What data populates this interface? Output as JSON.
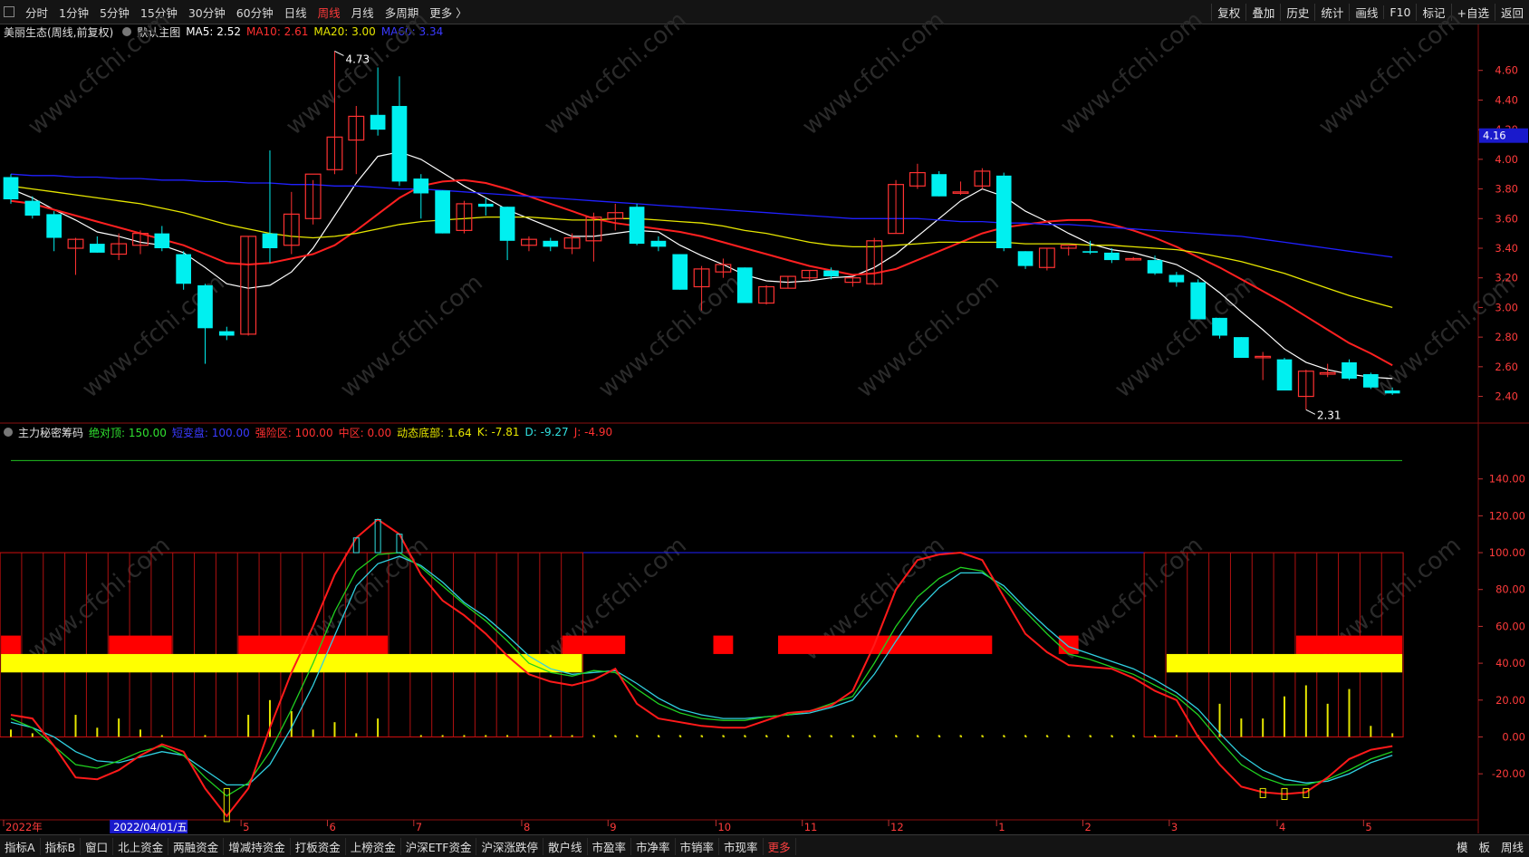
{
  "toolbar": {
    "periods": [
      "分时",
      "1分钟",
      "5分钟",
      "15分钟",
      "30分钟",
      "60分钟",
      "日线",
      "周线",
      "月线",
      "多周期",
      "更多 〉"
    ],
    "active_period": "周线",
    "right_buttons": [
      "复权",
      "叠加",
      "历史",
      "统计",
      "画线",
      "F10",
      "标记",
      "+自选",
      "返回"
    ]
  },
  "main_info": {
    "stock": "美丽生态(周线,前复权)",
    "template": "默认主图",
    "ma5": "MA5: 2.52",
    "ma10": "MA10: 2.61",
    "ma20": "MA20: 3.00",
    "ma60": "MA60: 3.34"
  },
  "indicator_info": {
    "name": "主力秘密筹码",
    "v1": "绝对顶: 150.00",
    "v2": "短变盘: 100.00",
    "v3": "强险区: 100.00",
    "v4": "中区: 0.00",
    "v5": "动态底部: 1.64",
    "k": "K: -7.81",
    "d": "D: -9.27",
    "j": "J: -4.90"
  },
  "price_axis": [
    "4.60",
    "4.40",
    "4.20",
    "4.00",
    "3.80",
    "3.60",
    "3.40",
    "3.20",
    "3.00",
    "2.80",
    "2.60",
    "2.40"
  ],
  "price_current": "4.16",
  "ind_axis": [
    "140.00",
    "120.00",
    "100.00",
    "80.00",
    "60.00",
    "40.00",
    "20.00",
    "0.00",
    "-20.00"
  ],
  "annotations": {
    "high": "4.73",
    "low": "2.31"
  },
  "x_labels": [
    "2022年",
    "2022/04/01/五",
    "5",
    "6",
    "7",
    "8",
    "9",
    "10",
    "11",
    "12",
    "1",
    "2",
    "3",
    "4",
    "5"
  ],
  "bottom_tabs": [
    "指标A",
    "指标B",
    "窗口",
    "北上资金",
    "两融资金",
    "增减持资金",
    "打板资金",
    "上榜资金",
    "沪深ETF资金",
    "沪深涨跌停",
    "散户线",
    "市盈率",
    "市净率",
    "市销率",
    "市现率",
    "更多"
  ],
  "bottom_right": [
    "模",
    "板",
    "周线"
  ],
  "watermark": "www.cfchi.com",
  "colors": {
    "up": "#ff3232",
    "down": "#00f0f0",
    "ma5": "#ffffff",
    "ma10": "#ff2020",
    "ma20": "#e6e600",
    "ma60": "#2020ff",
    "accent": "#ff3b3b"
  },
  "chart_data": {
    "type": "candlestick",
    "candles": [
      {
        "o": 3.88,
        "h": 3.9,
        "l": 3.7,
        "c": 3.73
      },
      {
        "o": 3.72,
        "h": 3.75,
        "l": 3.6,
        "c": 3.62
      },
      {
        "o": 3.63,
        "h": 3.65,
        "l": 3.38,
        "c": 3.47
      },
      {
        "o": 3.4,
        "h": 3.47,
        "l": 3.22,
        "c": 3.46
      },
      {
        "o": 3.43,
        "h": 3.48,
        "l": 3.37,
        "c": 3.37
      },
      {
        "o": 3.36,
        "h": 3.5,
        "l": 3.32,
        "c": 3.43
      },
      {
        "o": 3.42,
        "h": 3.52,
        "l": 3.36,
        "c": 3.5
      },
      {
        "o": 3.5,
        "h": 3.55,
        "l": 3.38,
        "c": 3.4
      },
      {
        "o": 3.36,
        "h": 3.38,
        "l": 3.12,
        "c": 3.16
      },
      {
        "o": 3.15,
        "h": 3.16,
        "l": 2.62,
        "c": 2.86
      },
      {
        "o": 2.84,
        "h": 2.87,
        "l": 2.78,
        "c": 2.81
      },
      {
        "o": 2.82,
        "h": 3.48,
        "l": 2.81,
        "c": 3.48
      },
      {
        "o": 3.5,
        "h": 4.06,
        "l": 3.3,
        "c": 3.4
      },
      {
        "o": 3.42,
        "h": 3.78,
        "l": 3.36,
        "c": 3.63
      },
      {
        "o": 3.6,
        "h": 3.86,
        "l": 3.56,
        "c": 3.9
      },
      {
        "o": 3.93,
        "h": 4.73,
        "l": 3.9,
        "c": 4.15
      },
      {
        "o": 4.13,
        "h": 4.36,
        "l": 3.9,
        "c": 4.29
      },
      {
        "o": 4.3,
        "h": 4.62,
        "l": 4.16,
        "c": 4.2
      },
      {
        "o": 4.36,
        "h": 4.56,
        "l": 3.82,
        "c": 3.85
      },
      {
        "o": 3.87,
        "h": 3.9,
        "l": 3.6,
        "c": 3.77
      },
      {
        "o": 3.79,
        "h": 3.79,
        "l": 3.5,
        "c": 3.5
      },
      {
        "o": 3.52,
        "h": 3.72,
        "l": 3.5,
        "c": 3.7
      },
      {
        "o": 3.7,
        "h": 3.74,
        "l": 3.62,
        "c": 3.68
      },
      {
        "o": 3.68,
        "h": 3.68,
        "l": 3.32,
        "c": 3.45
      },
      {
        "o": 3.42,
        "h": 3.48,
        "l": 3.38,
        "c": 3.46
      },
      {
        "o": 3.45,
        "h": 3.47,
        "l": 3.38,
        "c": 3.41
      },
      {
        "o": 3.4,
        "h": 3.5,
        "l": 3.36,
        "c": 3.47
      },
      {
        "o": 3.45,
        "h": 3.64,
        "l": 3.31,
        "c": 3.61
      },
      {
        "o": 3.6,
        "h": 3.7,
        "l": 3.52,
        "c": 3.64
      },
      {
        "o": 3.68,
        "h": 3.7,
        "l": 3.42,
        "c": 3.43
      },
      {
        "o": 3.45,
        "h": 3.48,
        "l": 3.38,
        "c": 3.41
      },
      {
        "o": 3.36,
        "h": 3.36,
        "l": 3.12,
        "c": 3.12
      },
      {
        "o": 3.14,
        "h": 3.28,
        "l": 2.98,
        "c": 3.26
      },
      {
        "o": 3.24,
        "h": 3.33,
        "l": 3.2,
        "c": 3.29
      },
      {
        "o": 3.27,
        "h": 3.27,
        "l": 3.03,
        "c": 3.03
      },
      {
        "o": 3.03,
        "h": 3.15,
        "l": 3.02,
        "c": 3.14
      },
      {
        "o": 3.13,
        "h": 3.21,
        "l": 3.13,
        "c": 3.21
      },
      {
        "o": 3.2,
        "h": 3.25,
        "l": 3.18,
        "c": 3.25
      },
      {
        "o": 3.25,
        "h": 3.27,
        "l": 3.19,
        "c": 3.21
      },
      {
        "o": 3.17,
        "h": 3.2,
        "l": 3.14,
        "c": 3.2
      },
      {
        "o": 3.16,
        "h": 3.47,
        "l": 3.15,
        "c": 3.45
      },
      {
        "o": 3.5,
        "h": 3.86,
        "l": 3.5,
        "c": 3.83
      },
      {
        "o": 3.82,
        "h": 3.97,
        "l": 3.8,
        "c": 3.91
      },
      {
        "o": 3.9,
        "h": 3.92,
        "l": 3.75,
        "c": 3.75
      },
      {
        "o": 3.78,
        "h": 3.85,
        "l": 3.76,
        "c": 3.78
      },
      {
        "o": 3.82,
        "h": 3.94,
        "l": 3.8,
        "c": 3.92
      },
      {
        "o": 3.89,
        "h": 3.91,
        "l": 3.38,
        "c": 3.4
      },
      {
        "o": 3.38,
        "h": 3.38,
        "l": 3.26,
        "c": 3.28
      },
      {
        "o": 3.27,
        "h": 3.4,
        "l": 3.25,
        "c": 3.4
      },
      {
        "o": 3.4,
        "h": 3.41,
        "l": 3.35,
        "c": 3.42
      },
      {
        "o": 3.38,
        "h": 3.45,
        "l": 3.36,
        "c": 3.37
      },
      {
        "o": 3.37,
        "h": 3.4,
        "l": 3.3,
        "c": 3.32
      },
      {
        "o": 3.33,
        "h": 3.34,
        "l": 3.32,
        "c": 3.33
      },
      {
        "o": 3.32,
        "h": 3.35,
        "l": 3.22,
        "c": 3.23
      },
      {
        "o": 3.22,
        "h": 3.24,
        "l": 3.14,
        "c": 3.17
      },
      {
        "o": 3.17,
        "h": 3.19,
        "l": 2.92,
        "c": 2.92
      },
      {
        "o": 2.93,
        "h": 2.93,
        "l": 2.79,
        "c": 2.81
      },
      {
        "o": 2.8,
        "h": 2.8,
        "l": 2.66,
        "c": 2.66
      },
      {
        "o": 2.67,
        "h": 2.7,
        "l": 2.51,
        "c": 2.67
      },
      {
        "o": 2.65,
        "h": 2.66,
        "l": 2.44,
        "c": 2.44
      },
      {
        "o": 2.4,
        "h": 2.58,
        "l": 2.31,
        "c": 2.57
      },
      {
        "o": 2.55,
        "h": 2.62,
        "l": 2.53,
        "c": 2.56
      },
      {
        "o": 2.63,
        "h": 2.65,
        "l": 2.51,
        "c": 2.52
      },
      {
        "o": 2.55,
        "h": 2.56,
        "l": 2.45,
        "c": 2.46
      },
      {
        "o": 2.44,
        "h": 2.46,
        "l": 2.41,
        "c": 2.42
      }
    ],
    "ma_series": {
      "ma5": [
        3.8,
        3.74,
        3.66,
        3.59,
        3.51,
        3.48,
        3.44,
        3.42,
        3.37,
        3.27,
        3.16,
        3.13,
        3.15,
        3.24,
        3.4,
        3.62,
        3.84,
        4.02,
        4.05,
        4.0,
        3.91,
        3.82,
        3.74,
        3.66,
        3.6,
        3.54,
        3.48,
        3.48,
        3.5,
        3.52,
        3.51,
        3.42,
        3.35,
        3.29,
        3.22,
        3.18,
        3.17,
        3.18,
        3.2,
        3.21,
        3.27,
        3.36,
        3.48,
        3.6,
        3.72,
        3.8,
        3.75,
        3.65,
        3.58,
        3.5,
        3.43,
        3.39,
        3.37,
        3.33,
        3.29,
        3.21,
        3.1,
        2.97,
        2.85,
        2.72,
        2.63,
        2.58,
        2.55,
        2.53,
        2.52
      ],
      "ma10": [
        3.72,
        3.7,
        3.66,
        3.62,
        3.58,
        3.54,
        3.5,
        3.46,
        3.42,
        3.36,
        3.3,
        3.29,
        3.3,
        3.33,
        3.36,
        3.42,
        3.52,
        3.63,
        3.74,
        3.82,
        3.85,
        3.86,
        3.84,
        3.8,
        3.75,
        3.7,
        3.65,
        3.6,
        3.57,
        3.55,
        3.53,
        3.51,
        3.48,
        3.44,
        3.4,
        3.36,
        3.32,
        3.28,
        3.25,
        3.22,
        3.23,
        3.26,
        3.32,
        3.38,
        3.44,
        3.5,
        3.54,
        3.56,
        3.58,
        3.59,
        3.59,
        3.56,
        3.52,
        3.47,
        3.41,
        3.34,
        3.27,
        3.19,
        3.11,
        3.03,
        2.94,
        2.85,
        2.76,
        2.69,
        2.61
      ],
      "ma20": [
        3.82,
        3.8,
        3.78,
        3.76,
        3.74,
        3.72,
        3.7,
        3.67,
        3.64,
        3.6,
        3.56,
        3.53,
        3.5,
        3.48,
        3.47,
        3.48,
        3.5,
        3.53,
        3.56,
        3.58,
        3.59,
        3.6,
        3.61,
        3.61,
        3.61,
        3.6,
        3.59,
        3.59,
        3.6,
        3.6,
        3.59,
        3.58,
        3.57,
        3.55,
        3.52,
        3.5,
        3.47,
        3.44,
        3.42,
        3.41,
        3.41,
        3.42,
        3.43,
        3.44,
        3.44,
        3.44,
        3.44,
        3.43,
        3.43,
        3.43,
        3.42,
        3.42,
        3.41,
        3.4,
        3.39,
        3.37,
        3.34,
        3.31,
        3.27,
        3.23,
        3.18,
        3.13,
        3.08,
        3.04,
        3.0
      ],
      "ma60": [
        3.9,
        3.89,
        3.89,
        3.88,
        3.88,
        3.87,
        3.87,
        3.86,
        3.86,
        3.85,
        3.85,
        3.84,
        3.84,
        3.83,
        3.83,
        3.82,
        3.82,
        3.81,
        3.8,
        3.8,
        3.79,
        3.78,
        3.77,
        3.76,
        3.75,
        3.74,
        3.73,
        3.72,
        3.71,
        3.7,
        3.69,
        3.68,
        3.67,
        3.66,
        3.65,
        3.64,
        3.63,
        3.62,
        3.61,
        3.6,
        3.6,
        3.6,
        3.6,
        3.59,
        3.58,
        3.58,
        3.57,
        3.57,
        3.56,
        3.56,
        3.55,
        3.54,
        3.53,
        3.52,
        3.51,
        3.5,
        3.49,
        3.48,
        3.46,
        3.44,
        3.42,
        3.4,
        3.38,
        3.36,
        3.34
      ]
    },
    "price_range": [
      2.22,
      4.8
    ],
    "indicator": {
      "range": [
        -45,
        160
      ],
      "k": [
        10,
        5,
        -5,
        -15,
        -17,
        -13,
        -8,
        -5,
        -10,
        -22,
        -32,
        -25,
        -8,
        15,
        40,
        68,
        90,
        99,
        100,
        92,
        82,
        72,
        63,
        52,
        40,
        35,
        33,
        36,
        35,
        26,
        18,
        13,
        10,
        9,
        9,
        11,
        12,
        14,
        18,
        22,
        40,
        60,
        76,
        86,
        92,
        90,
        80,
        68,
        56,
        45,
        42,
        38,
        34,
        28,
        22,
        12,
        -2,
        -15,
        -22,
        -26,
        -26,
        -23,
        -18,
        -12,
        -8
      ],
      "d": [
        8,
        5,
        0,
        -8,
        -13,
        -14,
        -11,
        -8,
        -10,
        -18,
        -26,
        -26,
        -15,
        5,
        28,
        55,
        82,
        94,
        98,
        93,
        84,
        73,
        65,
        55,
        44,
        37,
        34,
        35,
        36,
        29,
        21,
        15,
        12,
        10,
        10,
        11,
        12,
        13,
        16,
        20,
        34,
        52,
        69,
        81,
        89,
        89,
        82,
        70,
        59,
        49,
        45,
        41,
        37,
        31,
        24,
        15,
        2,
        -10,
        -18,
        -23,
        -25,
        -24,
        -20,
        -14,
        -10
      ],
      "j": [
        12,
        10,
        -5,
        -22,
        -23,
        -18,
        -10,
        -4,
        -8,
        -28,
        -43,
        -28,
        5,
        35,
        60,
        88,
        108,
        118,
        110,
        88,
        74,
        66,
        56,
        44,
        34,
        30,
        28,
        31,
        37,
        18,
        10,
        8,
        6,
        5,
        5,
        9,
        13,
        14,
        17,
        25,
        50,
        80,
        96,
        99,
        100,
        96,
        76,
        56,
        46,
        39,
        38,
        37,
        32,
        25,
        20,
        0,
        -15,
        -27,
        -30,
        -31,
        -30,
        -22,
        -12,
        -7,
        -5
      ],
      "zone_start_bands": [
        [
          0,
          26
        ],
        [
          27,
          0
        ],
        [
          53,
          64
        ]
      ],
      "red_bars": [
        [
          0,
          0
        ],
        [
          5,
          7
        ],
        [
          11,
          17
        ],
        [
          26,
          28
        ],
        [
          33,
          33
        ],
        [
          36,
          45
        ],
        [
          49,
          49
        ],
        [
          60,
          64
        ]
      ],
      "yellow_bars": [
        [
          0,
          26
        ],
        [
          54,
          64
        ]
      ],
      "small_bars": [
        4,
        2,
        0,
        12,
        5,
        10,
        4,
        1,
        0,
        1,
        0,
        12,
        20,
        14,
        4,
        8,
        2,
        10,
        0,
        1,
        1,
        1,
        1,
        1,
        0,
        1,
        1,
        1,
        1,
        1,
        1,
        1,
        1,
        1,
        1,
        1,
        1,
        1,
        1,
        1,
        1,
        1,
        1,
        1,
        1,
        1,
        1,
        1,
        1,
        1,
        1,
        1,
        1,
        1,
        1,
        1,
        18,
        10,
        10,
        22,
        28,
        18,
        26,
        6,
        2
      ]
    }
  }
}
